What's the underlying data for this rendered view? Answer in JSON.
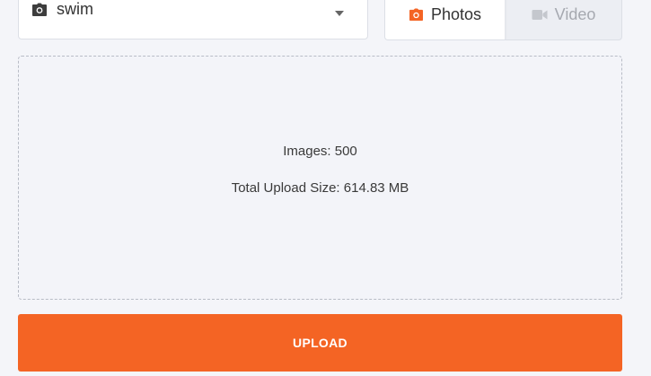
{
  "album_select": {
    "icon": "camera-icon",
    "value": "swim"
  },
  "media_toggle": {
    "photos": {
      "label": "Photos",
      "icon": "camera-icon",
      "active": true,
      "color": "#f46424"
    },
    "video": {
      "label": "Video",
      "icon": "video-camera-icon",
      "active": false
    }
  },
  "dropzone": {
    "images_text": "Images: 500",
    "size_text": "Total Upload Size: 614.83 MB"
  },
  "upload_button": {
    "label": "UPLOAD",
    "color": "#f46424"
  }
}
